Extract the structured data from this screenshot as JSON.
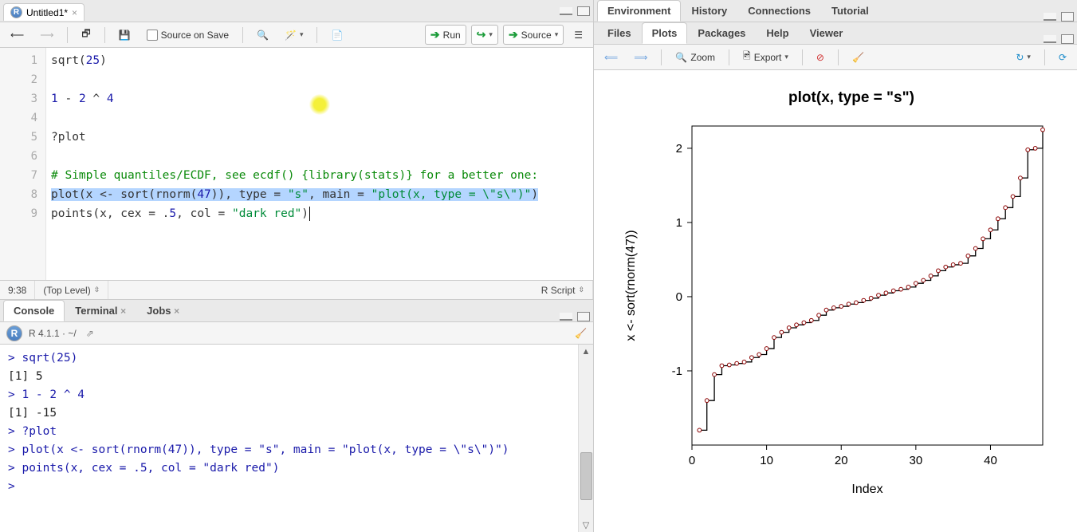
{
  "source": {
    "tab_title": "Untitled1*",
    "toolbar": {
      "source_on_save": "Source on Save",
      "run": "Run",
      "source": "Source"
    },
    "code_lines": [
      "sqrt(25)",
      "",
      "1 - 2 ^ 4",
      "",
      "?plot",
      "",
      "# Simple quantiles/ECDF, see ecdf() {library(stats)} for a better one:",
      "plot(x <- sort(rnorm(47)), type = \"s\", main = \"plot(x, type = \\\"s\\\")\")",
      "points(x, cex = .5, col = \"dark red\")"
    ],
    "status": {
      "cursor": "9:38",
      "scope": "(Top Level)",
      "filetype": "R Script"
    }
  },
  "console": {
    "tabs": {
      "console": "Console",
      "terminal": "Terminal",
      "jobs": "Jobs"
    },
    "version_line": "R 4.1.1 · ~/",
    "lines": [
      {
        "t": "pr",
        "v": "> sqrt(25)"
      },
      {
        "t": "out",
        "v": "[1] 5"
      },
      {
        "t": "pr",
        "v": "> 1 - 2 ^ 4"
      },
      {
        "t": "out",
        "v": "[1] -15"
      },
      {
        "t": "pr",
        "v": "> ?plot"
      },
      {
        "t": "pr",
        "v": "> plot(x <- sort(rnorm(47)), type = \"s\", main = \"plot(x, type = \\\"s\\\")\")"
      },
      {
        "t": "pr",
        "v": "> points(x, cex = .5, col = \"dark red\")"
      },
      {
        "t": "pr",
        "v": "> "
      }
    ]
  },
  "env": {
    "top_tabs": [
      "Environment",
      "History",
      "Connections",
      "Tutorial"
    ],
    "bottom_tabs": [
      "Files",
      "Plots",
      "Packages",
      "Help",
      "Viewer"
    ],
    "active_bottom": "Plots",
    "plot_toolbar": {
      "zoom": "Zoom",
      "export": "Export"
    }
  },
  "chart_data": {
    "type": "line",
    "plot_type": "step",
    "title": "plot(x, type = \"s\")",
    "xlabel": "Index",
    "ylabel": "x <- sort(rnorm(47))",
    "xlim": [
      0,
      47
    ],
    "ylim": [
      -2,
      2.3
    ],
    "xticks": [
      0,
      10,
      20,
      30,
      40
    ],
    "yticks": [
      -1,
      0,
      1,
      2
    ],
    "x": [
      1,
      2,
      3,
      4,
      5,
      6,
      7,
      8,
      9,
      10,
      11,
      12,
      13,
      14,
      15,
      16,
      17,
      18,
      19,
      20,
      21,
      22,
      23,
      24,
      25,
      26,
      27,
      28,
      29,
      30,
      31,
      32,
      33,
      34,
      35,
      36,
      37,
      38,
      39,
      40,
      41,
      42,
      43,
      44,
      45,
      46,
      47
    ],
    "y": [
      -1.8,
      -1.4,
      -1.05,
      -0.93,
      -0.92,
      -0.9,
      -0.88,
      -0.82,
      -0.78,
      -0.7,
      -0.55,
      -0.48,
      -0.42,
      -0.38,
      -0.35,
      -0.32,
      -0.25,
      -0.18,
      -0.15,
      -0.13,
      -0.1,
      -0.08,
      -0.05,
      -0.02,
      0.02,
      0.05,
      0.08,
      0.1,
      0.13,
      0.18,
      0.22,
      0.28,
      0.35,
      0.4,
      0.43,
      0.45,
      0.55,
      0.65,
      0.78,
      0.9,
      1.05,
      1.2,
      1.35,
      1.6,
      1.98,
      2.0,
      2.25
    ],
    "point_color": "#8b0000",
    "point_size": 0.5
  }
}
